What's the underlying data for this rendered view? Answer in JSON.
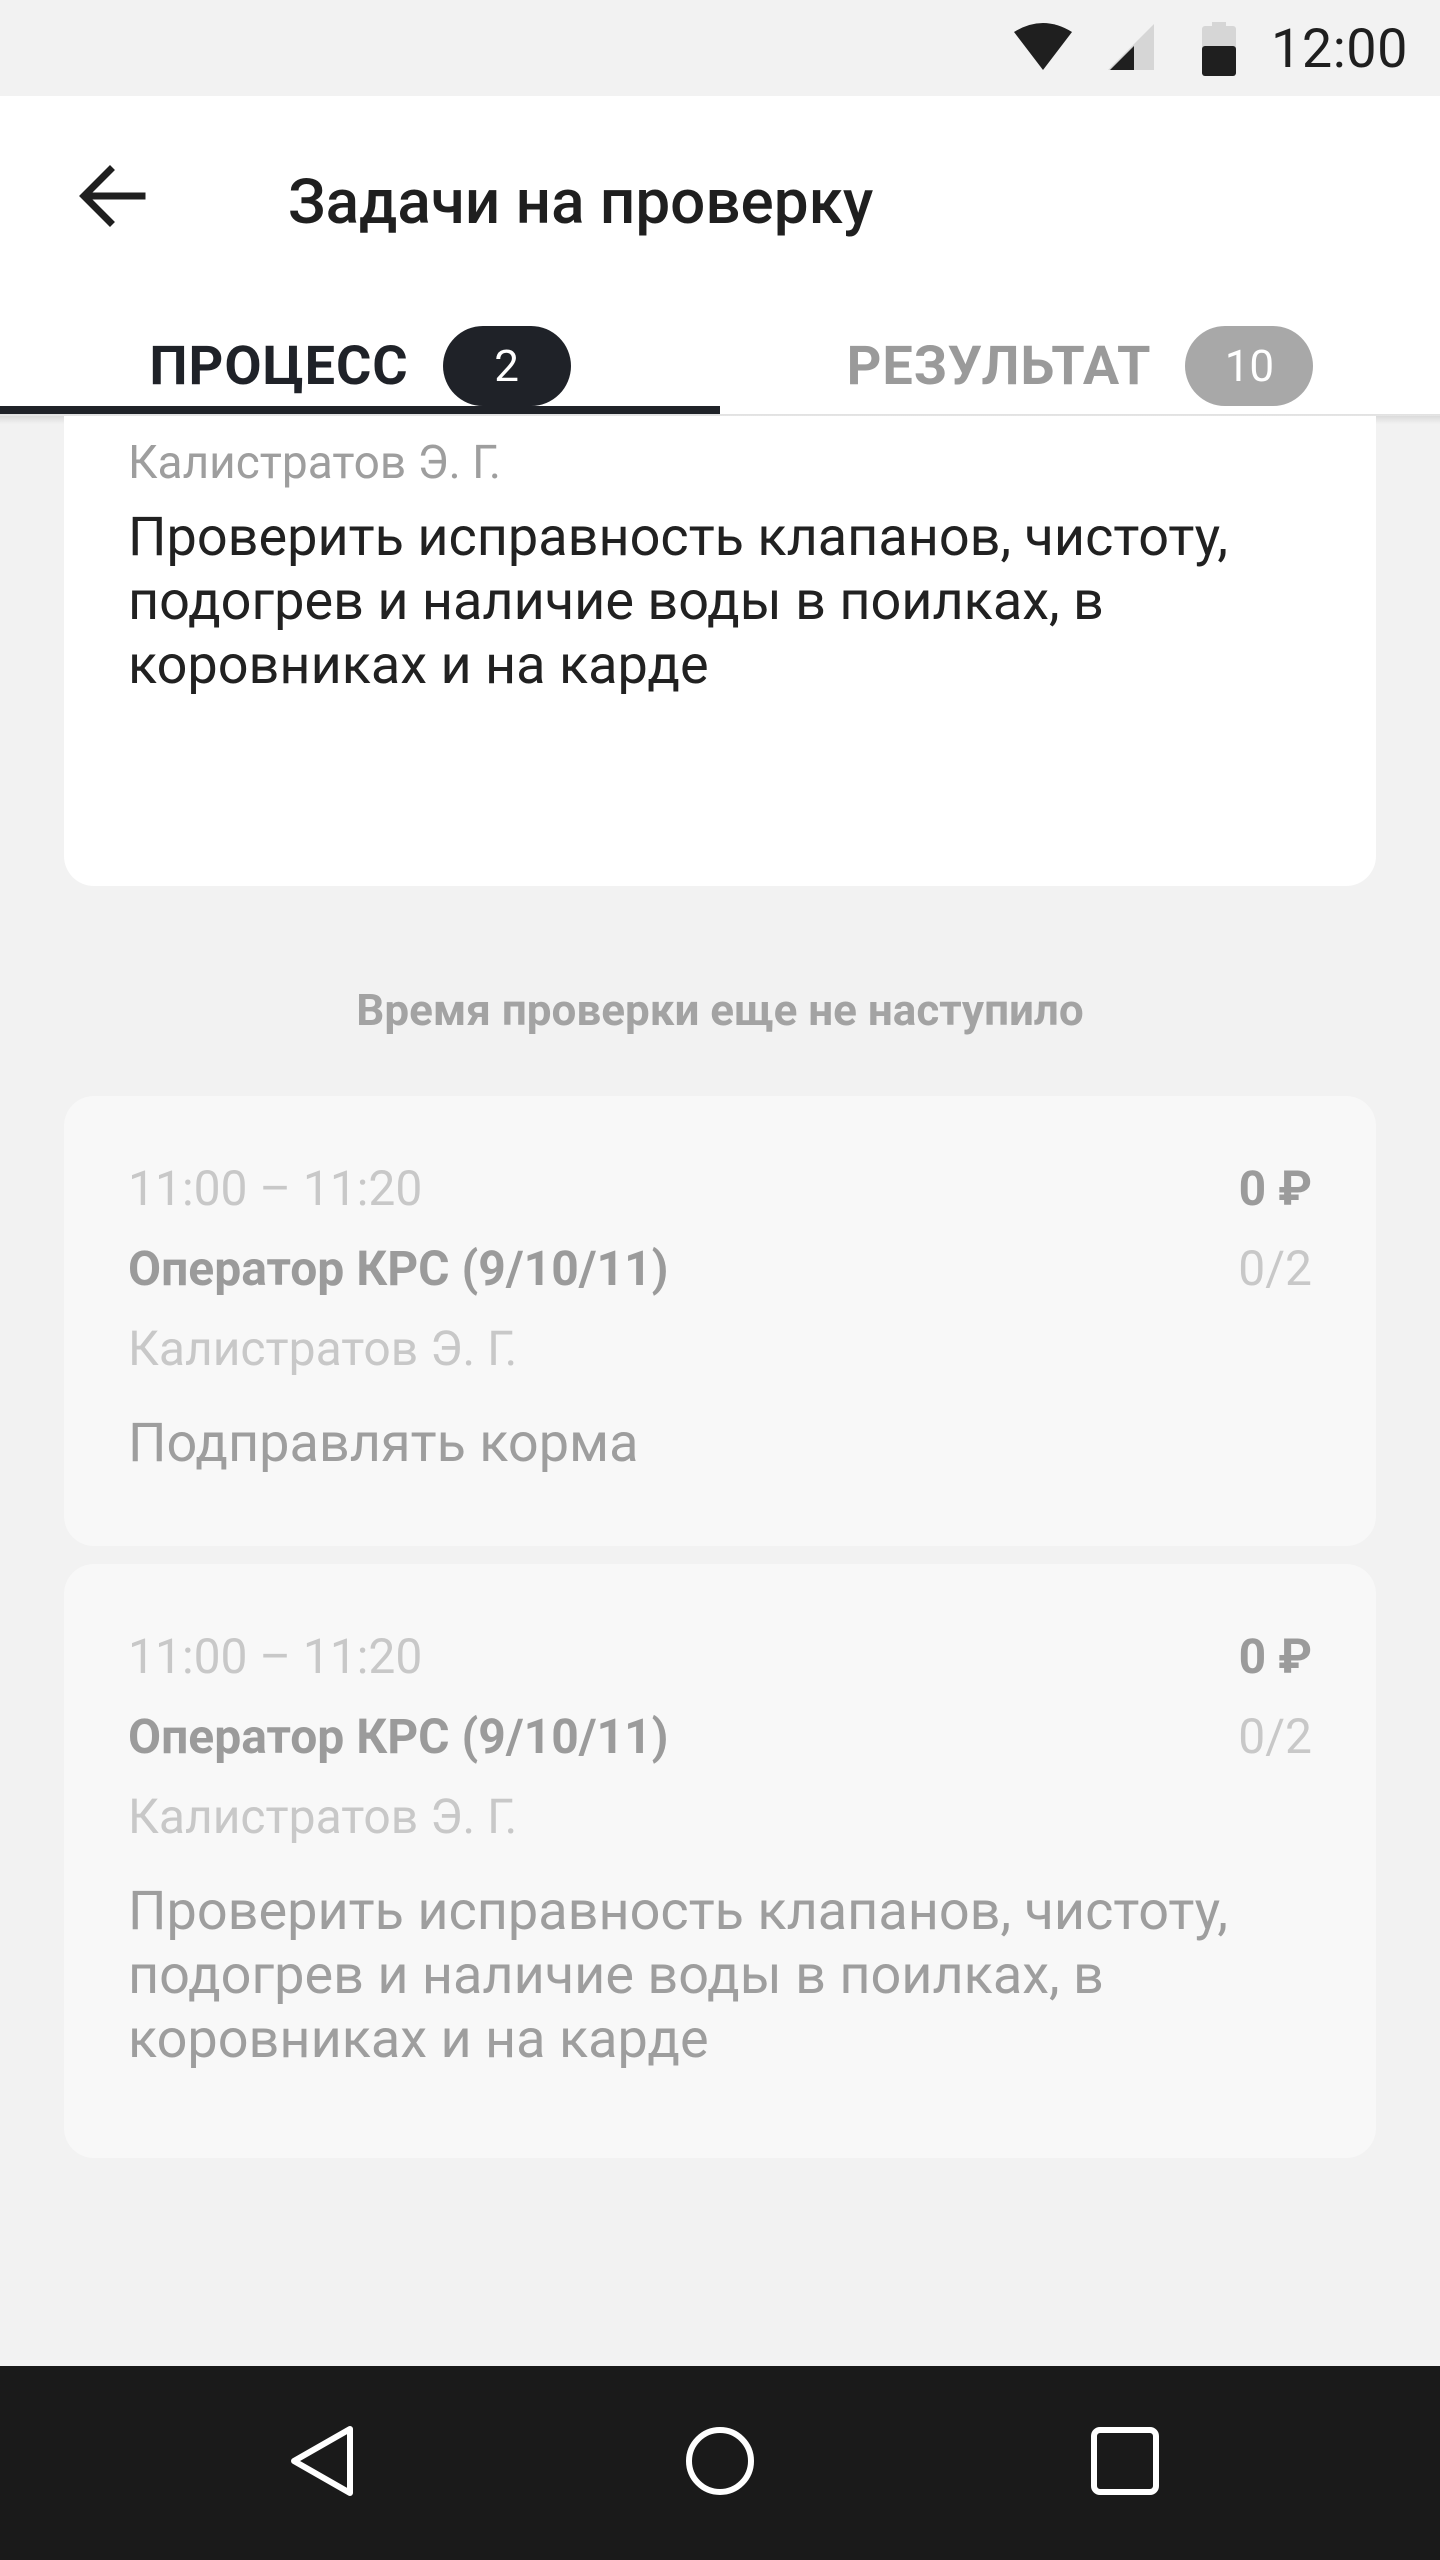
{
  "status_bar": {
    "time": "12:00",
    "icons": [
      "wifi-icon",
      "cellular-signal-icon",
      "battery-icon"
    ]
  },
  "app_bar": {
    "title": "Задачи на проверку",
    "back_icon": "arrow-left-icon"
  },
  "tabs": [
    {
      "label": "ПРОЦЕСС",
      "count": "2",
      "selected": true
    },
    {
      "label": "РЕЗУЛЬТАТ",
      "count": "10",
      "selected": false
    }
  ],
  "top_card": {
    "assignee": "Калистратов Э. Г.",
    "description": "Проверить исправность клапанов, чистоту, подогрев и наличие воды в поилках, в коровниках и на карде"
  },
  "upcoming_section_label": "Время проверки еще не наступило",
  "upcoming_tasks": [
    {
      "time_range": "11:00 – 11:20",
      "price": "0 ₽",
      "role": "Оператор КРС (9/10/11)",
      "progress": "0/2",
      "assignee": "Калистратов Э. Г.",
      "description": "Подправлять корма"
    },
    {
      "time_range": "11:00 – 11:20",
      "price": "0 ₽",
      "role": "Оператор КРС (9/10/11)",
      "progress": "0/2",
      "assignee": "Калистратов Э. Г.",
      "description": "Проверить исправность клапанов, чистоту, подогрев и наличие воды в поилках, в коровниках и на карде"
    }
  ],
  "nav_bar": {
    "icons": [
      "nav-back-icon",
      "nav-home-icon",
      "nav-recents-icon"
    ]
  },
  "colors": {
    "background": "#f2f2f2",
    "surface": "#ffffff",
    "accent_dark": "#1f2228",
    "muted_text": "#9b9b9b",
    "nav_bar": "#1a1a1a"
  }
}
